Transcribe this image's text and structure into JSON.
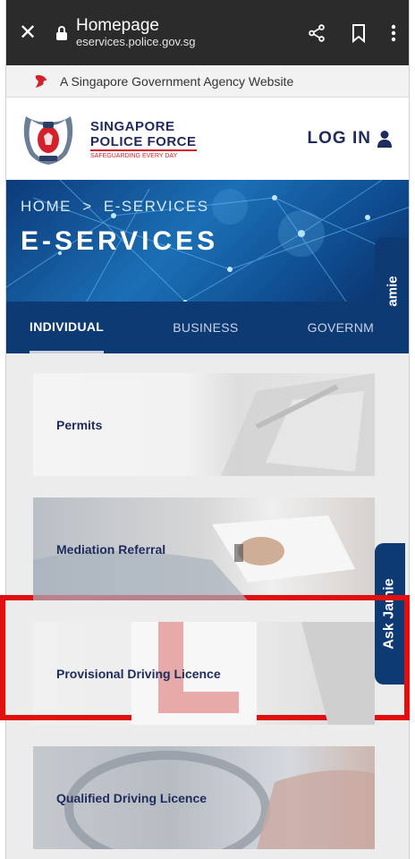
{
  "browser": {
    "title": "Homepage",
    "url": "eservices.police.gov.sg",
    "icons": [
      "close-icon",
      "lock-icon",
      "share-icon",
      "bookmark-icon",
      "more-vert-icon"
    ]
  },
  "gov_strip": {
    "text": "A Singapore Government Agency Website"
  },
  "header": {
    "brand_line1": "SINGAPORE",
    "brand_line2": "POLICE FORCE",
    "tagline": "SAFEGUARDING EVERY DAY",
    "login_label": "LOG IN"
  },
  "hero": {
    "breadcrumb_home": "HOME",
    "breadcrumb_sep": ">",
    "breadcrumb_current": "E-SERVICES",
    "title": "E-SERVICES"
  },
  "tabs": [
    {
      "label": "INDIVIDUAL",
      "active": true
    },
    {
      "label": "BUSINESS",
      "active": false
    },
    {
      "label": "GOVERNMENT",
      "active": false
    }
  ],
  "cards": [
    {
      "label": "Permits"
    },
    {
      "label": "Mediation Referral"
    },
    {
      "label": "Provisional Driving Licence"
    },
    {
      "label": "Qualified Driving Licence"
    }
  ],
  "ask_jamie": {
    "short_label": "amie",
    "label": "Ask Jamie"
  },
  "colors": {
    "navy": "#0e3a74",
    "brand_red": "#d4202a",
    "highlight": "#e01010"
  }
}
